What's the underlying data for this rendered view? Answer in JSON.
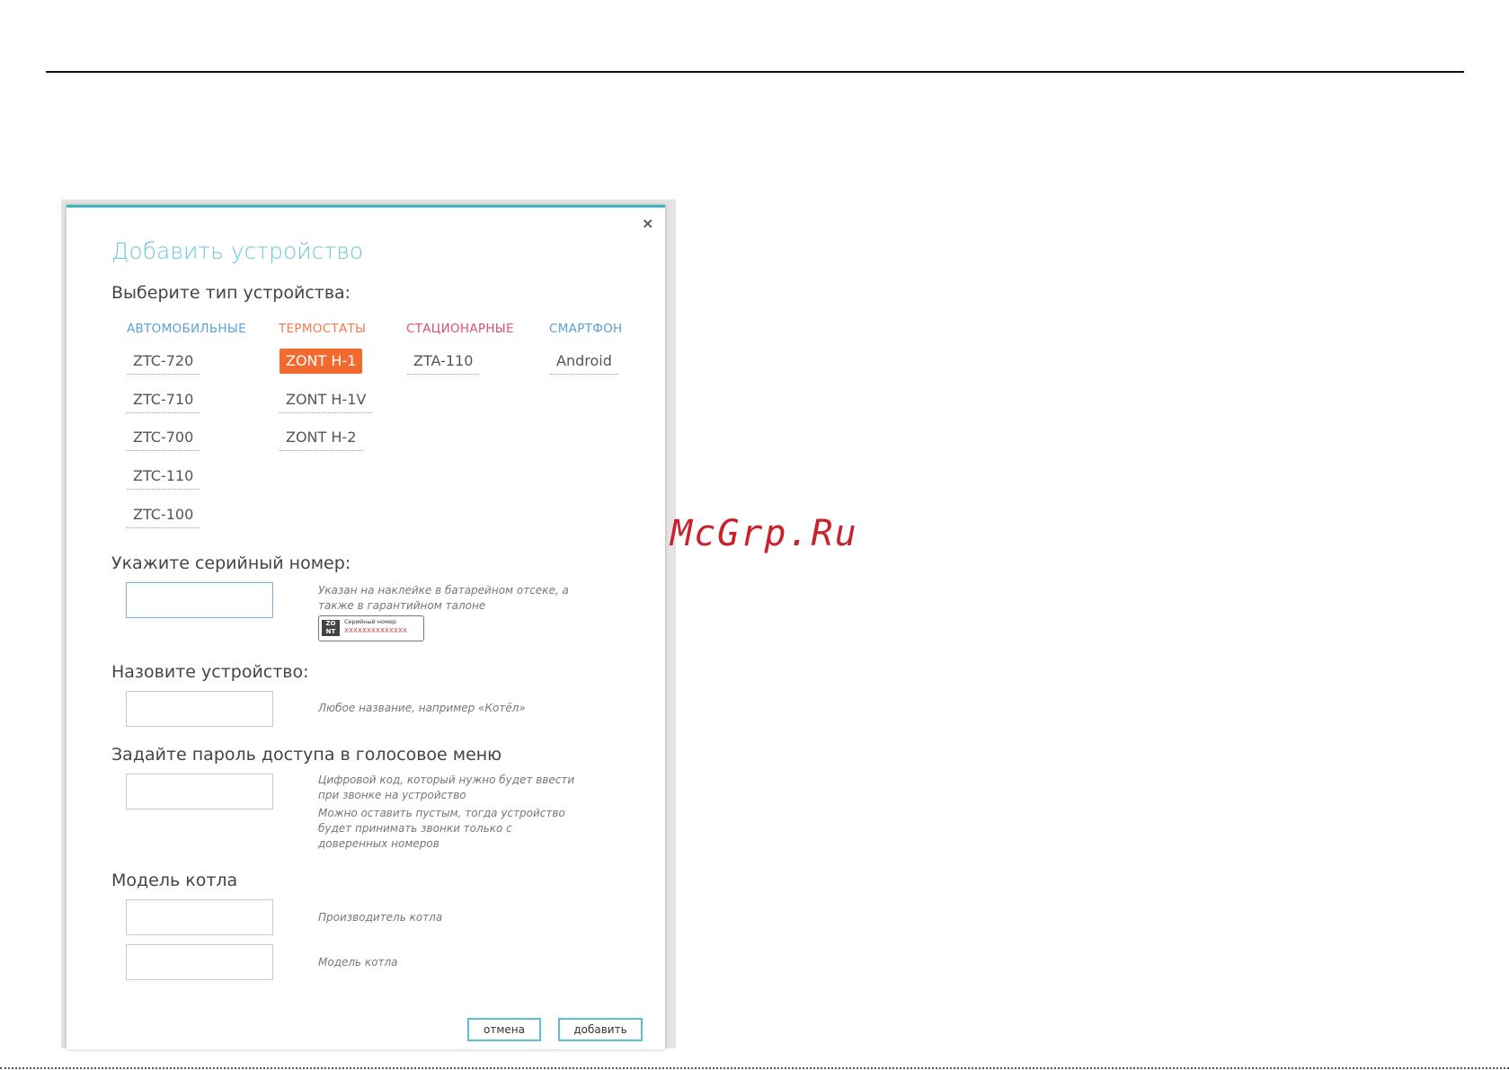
{
  "watermark": "McGrp.Ru",
  "dialog": {
    "title": "Добавить устройство",
    "close_label": "×",
    "device_type_label": "Выберите тип устройства:",
    "categories": {
      "auto": {
        "label": "АВТОМОБИЛЬНЫЕ",
        "items": [
          "ZTC-720",
          "ZTC-710",
          "ZTC-700",
          "ZTC-110",
          "ZTC-100"
        ]
      },
      "thermo": {
        "label": "ТЕРМОСТАТЫ",
        "items": [
          "ZONT H-1",
          "ZONT H-1V",
          "ZONT H-2"
        ],
        "selected": "ZONT H-1"
      },
      "stationary": {
        "label": "СТАЦИОНАРНЫЕ",
        "items": [
          "ZTA-110"
        ]
      },
      "phone": {
        "label": "СМАРТФОН",
        "items": [
          "Android"
        ]
      }
    },
    "serial": {
      "label": "Укажите серийный номер:",
      "value": "",
      "hint": "Указан на наклейке в батарейном отсеке, а также в гарантийном талоне",
      "badge_logo": "ZO NT",
      "badge_caption": "Серийный номер",
      "badge_number": "XXXXXXXXXXXXXX"
    },
    "name": {
      "label": "Назовите устройство:",
      "value": "",
      "hint": "Любое название, например «Котёл»"
    },
    "password": {
      "label": "Задайте пароль доступа в голосовое меню",
      "value": "",
      "hint1": "Цифровой код, который нужно будет ввести при звонке на устройство",
      "hint2": "Можно оставить пустым, тогда устройство будет принимать звонки только с доверенных номеров"
    },
    "boiler": {
      "label": "Модель котла",
      "manufacturer_value": "",
      "manufacturer_hint": "Производитель котла",
      "model_value": "",
      "model_hint": "Модель котла"
    },
    "buttons": {
      "cancel": "отмена",
      "add": "добавить"
    }
  },
  "colors": {
    "accent": "#36b6c0",
    "selected": "#f26a2e",
    "auto": "#5a9fd6",
    "thermo": "#f07b4f",
    "stationary": "#d95370"
  }
}
